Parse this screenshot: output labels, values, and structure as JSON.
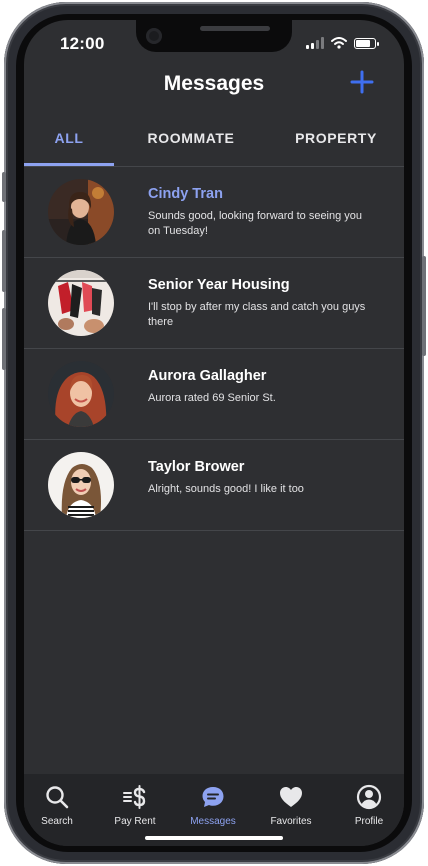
{
  "status": {
    "time": "12:00"
  },
  "header": {
    "title": "Messages",
    "add_icon": "plus-icon"
  },
  "tabs": [
    {
      "label": "ALL",
      "active": true
    },
    {
      "label": "ROOMMATE",
      "active": false
    },
    {
      "label": "PROPERTY",
      "active": false
    }
  ],
  "conversations": [
    {
      "name": "Cindy Tran",
      "preview": "Sounds good, looking forward to seeing you on Tuesday!",
      "unread": true
    },
    {
      "name": "Senior Year Housing",
      "preview": "I'll stop by after my class and catch you guys there",
      "unread": false
    },
    {
      "name": "Aurora Gallagher",
      "preview": "Aurora rated 69 Senior St.",
      "unread": false
    },
    {
      "name": "Taylor Brower",
      "preview": "Alright, sounds good! I like it too",
      "unread": false
    }
  ],
  "bottom_nav": [
    {
      "label": "Search",
      "icon": "search-icon",
      "active": false
    },
    {
      "label": "Pay Rent",
      "icon": "dollar-icon",
      "active": false
    },
    {
      "label": "Messages",
      "icon": "chat-icon",
      "active": true
    },
    {
      "label": "Favorites",
      "icon": "heart-icon",
      "active": false
    },
    {
      "label": "Profile",
      "icon": "user-icon",
      "active": false
    }
  ],
  "colors": {
    "accent": "#8da2f0",
    "add_button": "#3f6ff0",
    "background": "#2e2f32"
  }
}
